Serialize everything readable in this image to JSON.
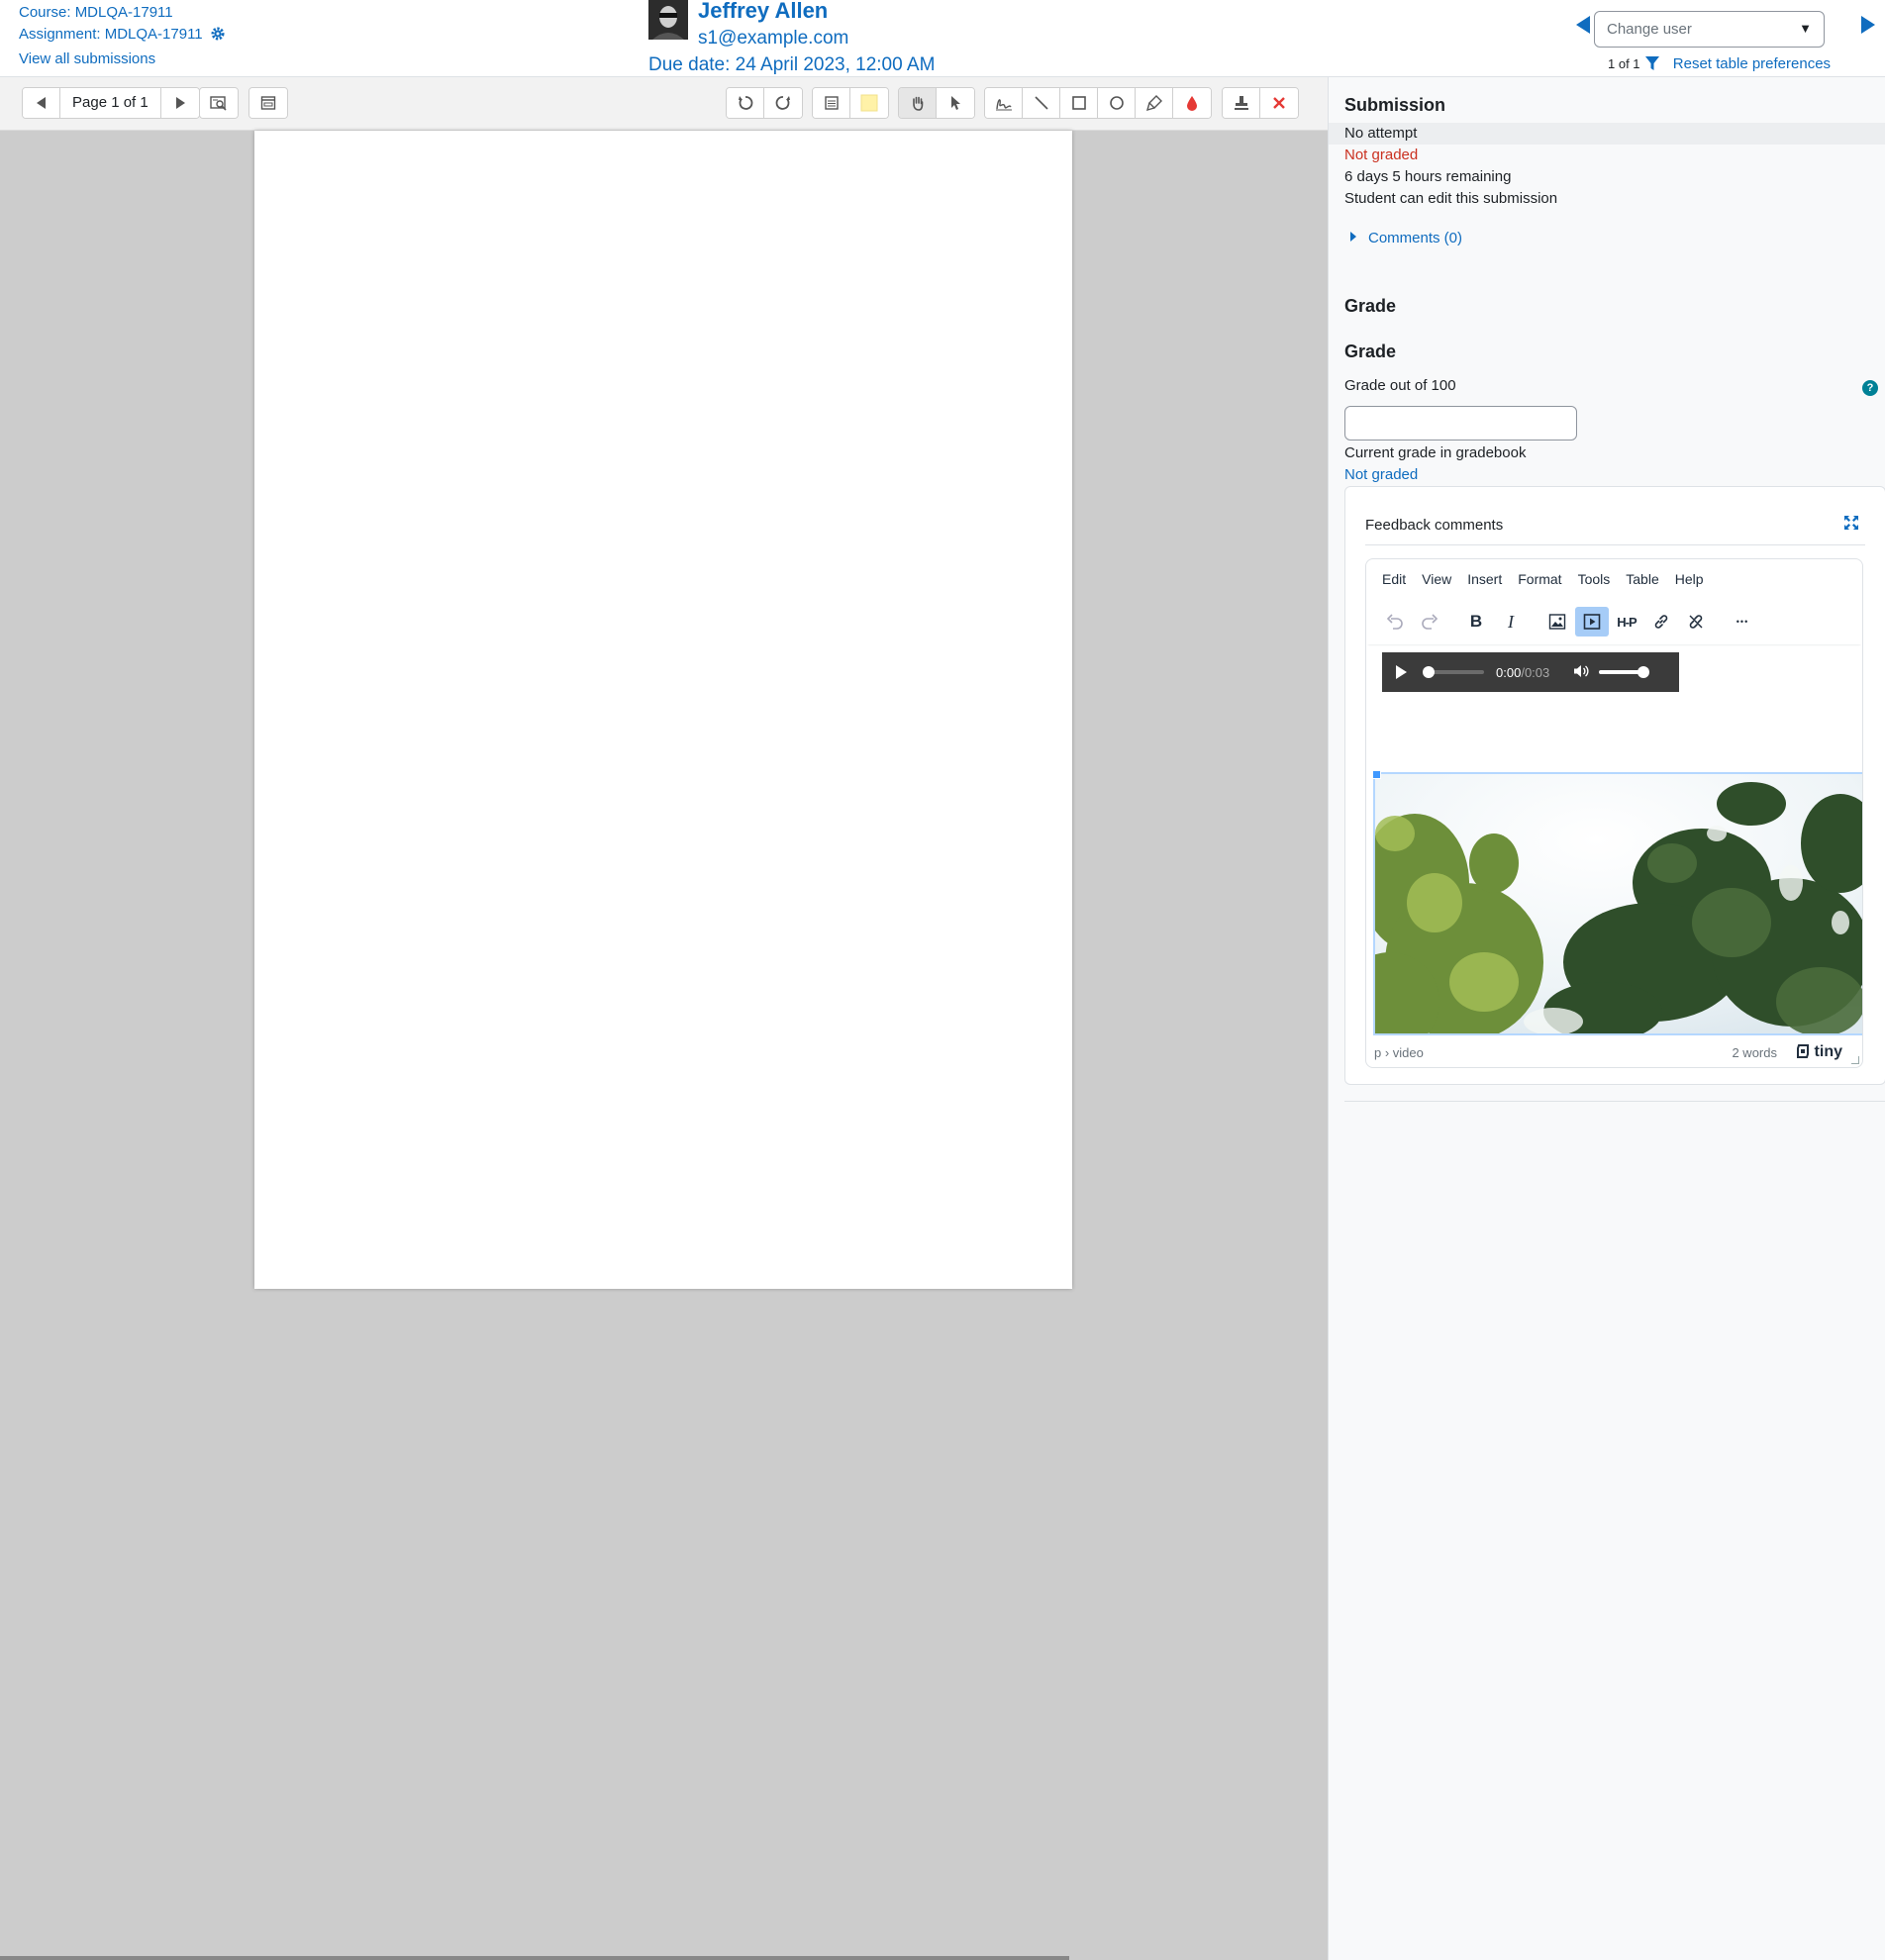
{
  "header": {
    "course_link": "Course: MDLQA-17911",
    "assignment_link": "Assignment: MDLQA-17911",
    "view_all_link": "View all submissions",
    "user_name": "Jeffrey Allen",
    "user_email": "s1@example.com",
    "due_date": "Due date: 24 April 2023, 12:00 AM",
    "change_user_placeholder": "Change user",
    "user_count": "1 of 1",
    "reset_link": "Reset table preferences"
  },
  "viewer": {
    "page_label": "Page 1 of 1"
  },
  "panel": {
    "submission_heading": "Submission",
    "status_attempt": "No attempt",
    "status_graded": "Not graded",
    "time_remaining": "6 days 5 hours remaining",
    "edit_status": "Student can edit this submission",
    "comments_toggle": "Comments (0)",
    "grade_heading": "Grade",
    "grade_subheading": "Grade",
    "grade_out_of": "Grade out of 100",
    "help_glyph": "?",
    "current_grade_label": "Current grade in gradebook",
    "current_grade_value": "Not graded",
    "feedback_title": "Feedback comments"
  },
  "editor": {
    "menu": [
      "Edit",
      "View",
      "Insert",
      "Format",
      "Tools",
      "Table",
      "Help"
    ],
    "bold_glyph": "B",
    "italic_glyph": "I",
    "h5p_label": "H-P",
    "more_glyph": "•••",
    "audio_time_current": "0:00",
    "audio_time_sep": " / ",
    "audio_time_total": "0:03",
    "status_path": "p › video",
    "word_count": "2 words",
    "brand": "tiny"
  },
  "colors": {
    "link": "#0f6cbf",
    "danger": "#ca3120",
    "viewer_bg": "#cccccc",
    "panel_bg": "#f8f9fa",
    "help_badge": "#008196",
    "active_tool": "#a6ccf7"
  }
}
